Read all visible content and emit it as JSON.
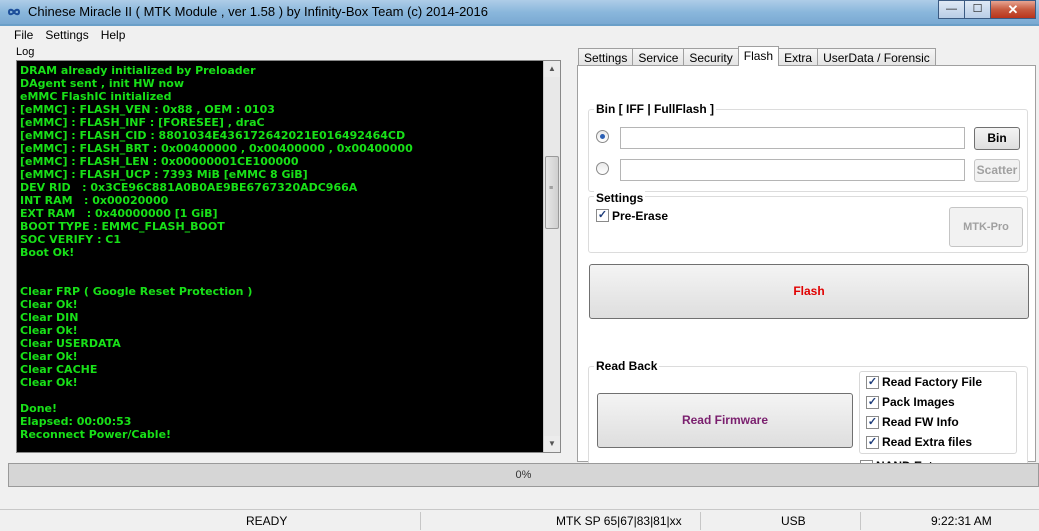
{
  "window": {
    "title": "Chinese Miracle II ( MTK Module , ver 1.58 ) by Infinity-Box Team (c) 2014-2016",
    "minimize": "—",
    "maximize": "☐",
    "close": "✕"
  },
  "menu": [
    "File",
    "Settings",
    "Help"
  ],
  "log": {
    "label": "Log",
    "text_color": "#18e018",
    "lines": [
      "DRAM already initialized by Preloader",
      "DAgent sent , init HW now",
      "eMMC FlashIC initialized",
      "[eMMC] : FLASH_VEN : 0x88 , OEM : 0103",
      "[eMMC] : FLASH_INF : [FORESEE] , draC",
      "[eMMC] : FLASH_CID : 8801034E436172642021E016492464CD",
      "[eMMC] : FLASH_BRT : 0x00400000 , 0x00400000 , 0x00400000",
      "[eMMC] : FLASH_LEN : 0x00000001CE100000",
      "[eMMC] : FLASH_UCP : 7393 MiB [eMMC 8 GiB]",
      "DEV RID   : 0x3CE96C881A0B0AE9BE6767320ADC966A",
      "INT RAM   : 0x00020000",
      "EXT RAM   : 0x40000000 [1 GiB]",
      "BOOT TYPE : EMMC_FLASH_BOOT",
      "SOC VERIFY : C1",
      "Boot Ok!",
      "",
      "",
      "Clear FRP ( Google Reset Protection )",
      "Clear Ok!",
      "Clear DIN",
      "Clear Ok!",
      "Clear USERDATA",
      "Clear Ok!",
      "Clear CACHE",
      "Clear Ok!",
      "",
      "Done!",
      "Elapsed: 00:00:53",
      "Reconnect Power/Cable!"
    ]
  },
  "tabs": [
    {
      "label": "Settings",
      "active": false
    },
    {
      "label": "Service",
      "active": false
    },
    {
      "label": "Security",
      "active": false
    },
    {
      "label": "Flash",
      "active": true
    },
    {
      "label": "Extra",
      "active": false
    },
    {
      "label": "UserData / Forensic",
      "active": false
    }
  ],
  "flash_panel": {
    "bin_group_title": "Bin  [ IFF | FullFlash ]",
    "bin_path_value": "",
    "scatter_path_value": "",
    "bin_button": "Bin",
    "scatter_button": "Scatter",
    "settings_title": "Settings",
    "pre_erase_label": "Pre-Erase",
    "pre_erase_checked": true,
    "mtk_pro_button": "MTK-Pro",
    "flash_button": "Flash",
    "flash_color": "#e00000",
    "readback_title": "Read Back",
    "read_firmware_button": "Read Firmware",
    "read_firmware_color": "#7a1f6e",
    "options": [
      {
        "label": "Read Factory File",
        "checked": true
      },
      {
        "label": "Pack Images",
        "checked": true
      },
      {
        "label": "Read FW Info",
        "checked": true
      },
      {
        "label": "Read Extra files",
        "checked": true
      }
    ],
    "nand_extra_label": "NAND Extra",
    "nand_extra_checked": false
  },
  "progress": {
    "text": "0%",
    "fraction": 0
  },
  "status": {
    "state": "READY",
    "platform": "MTK SP 65|67|83|81|xx",
    "connection": "USB",
    "time": "9:22:31 AM"
  }
}
